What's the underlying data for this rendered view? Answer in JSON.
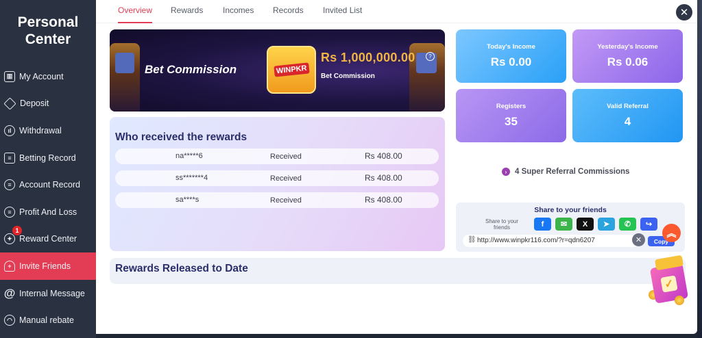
{
  "sidebar": {
    "title_line1": "Personal",
    "title_line2": "Center",
    "items": [
      {
        "label": "My Account",
        "icon": "wallet-icon"
      },
      {
        "label": "Deposit",
        "icon": "deposit-icon"
      },
      {
        "label": "Withdrawal",
        "icon": "withdrawal-icon"
      },
      {
        "label": "Betting Record",
        "icon": "document-icon"
      },
      {
        "label": "Account Record",
        "icon": "list-icon"
      },
      {
        "label": "Profit And Loss",
        "icon": "chart-icon"
      },
      {
        "label": "Reward Center",
        "icon": "gift-icon",
        "badge": "1"
      },
      {
        "label": "Invite Friends",
        "icon": "invite-friends-icon"
      },
      {
        "label": "Internal Message",
        "icon": "at-icon"
      },
      {
        "label": "Manual rebate",
        "icon": "rebate-icon"
      }
    ],
    "active_color": "#e33d56"
  },
  "tabs": [
    "Overview",
    "Rewards",
    "Incomes",
    "Records",
    "Invited List"
  ],
  "close_symbol": "✕",
  "banner": {
    "title": "Bet Commission",
    "logo_text": "WINPKR",
    "amount": "Rs  1,000,000.00",
    "subtitle": "Bet Commission",
    "help": "?"
  },
  "rewards": {
    "title": "Who received the rewards",
    "rows": [
      {
        "name": "na*****6",
        "status": "Received",
        "amount": "Rs  408.00"
      },
      {
        "name": "ss*******4",
        "status": "Received",
        "amount": "Rs  408.00"
      },
      {
        "name": "sa****s",
        "status": "Received",
        "amount": "Rs  408.00"
      }
    ]
  },
  "stats": {
    "today_label": "Today's Income",
    "today_value": "Rs  0.00",
    "yesterday_label": "Yesterday's Income",
    "yesterday_value": "Rs  0.06",
    "registers_label": "Registers",
    "registers_value": "35",
    "valid_label": "Valid Referral",
    "valid_value": "4"
  },
  "super_referral": "4 Super Referral Commissions",
  "share": {
    "title": "Share to your friends",
    "label": "Share to your friends",
    "buttons": [
      {
        "name": "facebook",
        "glyph": "f",
        "color": "#1877f2"
      },
      {
        "name": "sms",
        "glyph": "✉",
        "color": "#3bb54a"
      },
      {
        "name": "x",
        "glyph": "X",
        "color": "#111111"
      },
      {
        "name": "telegram",
        "glyph": "➤",
        "color": "#2aa3df"
      },
      {
        "name": "whatsapp",
        "glyph": "✆",
        "color": "#25c354"
      },
      {
        "name": "forward",
        "glyph": "↪",
        "color": "#3b63f0"
      }
    ],
    "url": "http://www.winpkr116.com/?r=qdn6207",
    "copy_label": "Copy"
  },
  "released_title": "Rewards Released to Date"
}
